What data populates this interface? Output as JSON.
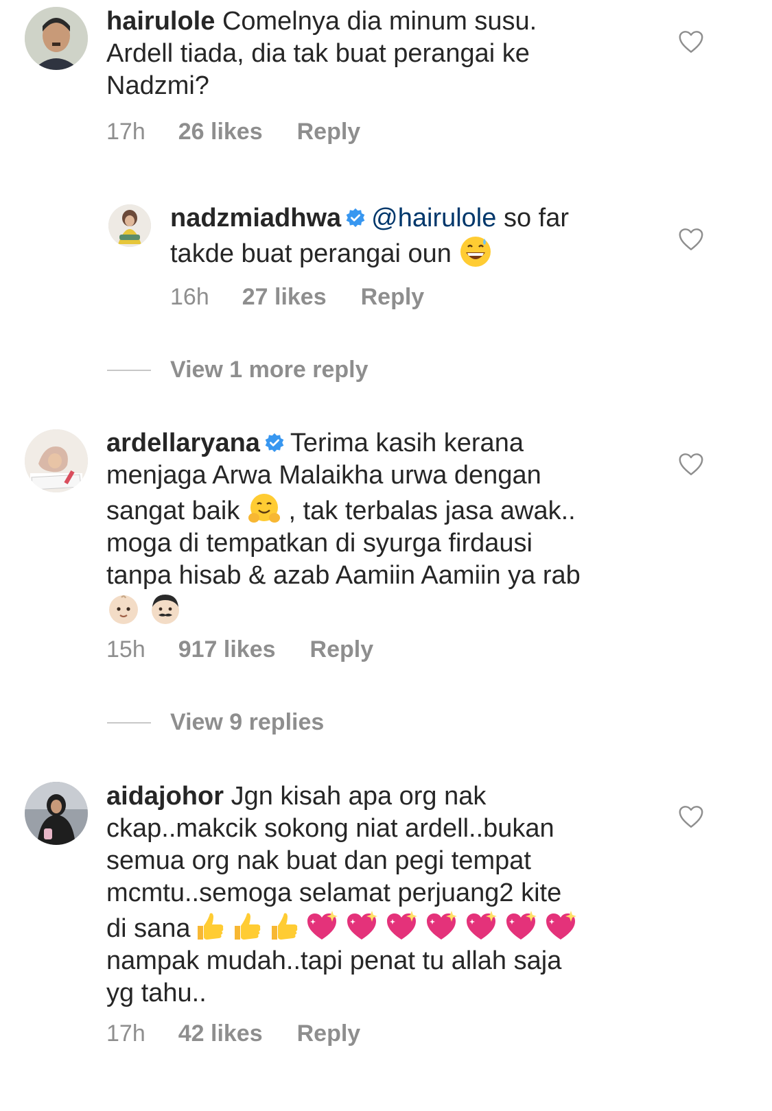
{
  "comments": [
    {
      "username": "hairulole",
      "text_line1": "Comelnya dia minum susu.",
      "text_line2": "Ardell tiada, dia tak buat perangai ke",
      "text_line3": "Nadzmi?",
      "time": "17h",
      "likes": "26 likes",
      "reply": "Reply",
      "avatar_icon": "profile-photo",
      "like_icon": "heart-outline-icon"
    },
    {
      "username": "nadzmiadhwa",
      "verified_icon": "verified-badge-icon",
      "mention": "@hairulole",
      "text_line1_rest": "so far",
      "text_line2": "takde buat perangai oun",
      "emoji": "grinning-face-with-sweat",
      "time": "16h",
      "likes": "27 likes",
      "reply": "Reply",
      "like_icon": "heart-outline-icon"
    },
    {
      "username": "ardellaryana",
      "verified_icon": "verified-badge-icon",
      "text_line1": "Terima kasih kerana",
      "text_line2": "menjaga Arwa Malaikha urwa dengan",
      "text_line3_a": "sangat baik",
      "text_line3_b": ", tak terbalas jasa awak..",
      "text_line4": "moga di tempatkan di syurga firdausi",
      "text_line5": "tanpa hisab & azab  Aamiin Aamiin ya rab",
      "emojis": [
        "hugging-face",
        "baby",
        "man-with-mustache"
      ],
      "time": "15h",
      "likes": "917 likes",
      "reply": "Reply",
      "like_icon": "heart-outline-icon"
    },
    {
      "username": "aidajohor",
      "text_line1": "Jgn kisah apa org nak",
      "text_line2": "ckap..makcik sokong niat ardell..bukan",
      "text_line3": "semua org nak buat dan pegi tempat",
      "text_line4": "mcmtu..semoga selamat perjuang2 kite",
      "text_line5": "di sana",
      "text_line6": "nampak mudah..tapi penat tu allah saja",
      "text_line7": "yg tahu..",
      "emojis": [
        "thumbs-up",
        "thumbs-up",
        "thumbs-up",
        "sparkling-heart",
        "sparkling-heart",
        "sparkling-heart",
        "sparkling-heart",
        "sparkling-heart",
        "sparkling-heart",
        "sparkling-heart"
      ],
      "time": "17h",
      "likes": "42 likes",
      "reply": "Reply",
      "like_icon": "heart-outline-icon"
    }
  ],
  "view_more_1": "View 1 more reply",
  "view_more_2": "View 9 replies",
  "colors": {
    "text": "#262626",
    "meta": "#8e8e8e",
    "mention": "#00376b",
    "verified": "#3897f0",
    "heart_stroke": "#8e8e8e"
  }
}
